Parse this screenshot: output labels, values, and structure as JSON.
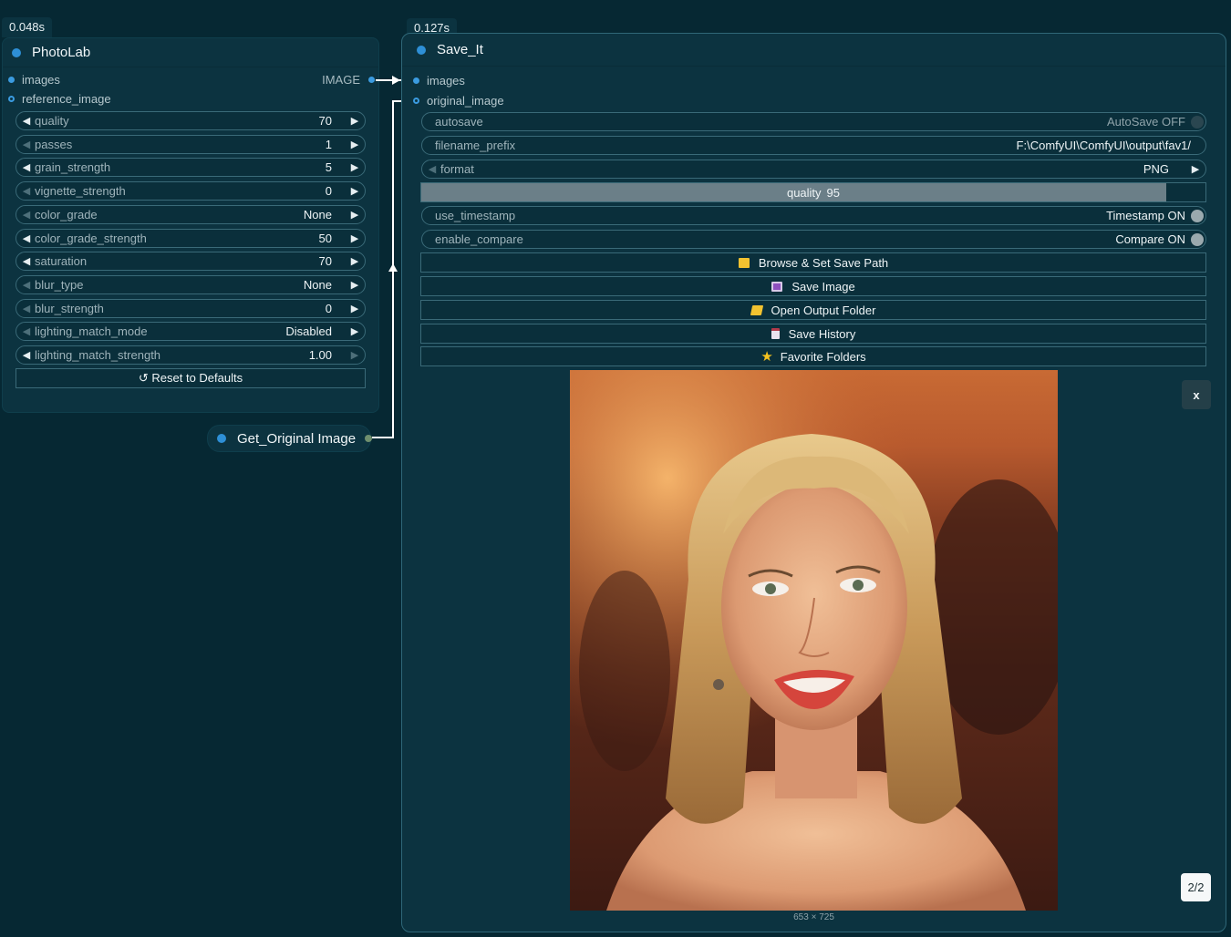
{
  "photolab": {
    "timing": "0.048s",
    "title": "PhotoLab",
    "inputs": [
      {
        "label": "images",
        "type": "IMAGE"
      },
      {
        "label": "reference_image"
      }
    ],
    "widgets": [
      {
        "label": "quality",
        "value": "70"
      },
      {
        "label": "passes",
        "value": "1"
      },
      {
        "label": "grain_strength",
        "value": "5"
      },
      {
        "label": "vignette_strength",
        "value": "0"
      },
      {
        "label": "color_grade",
        "value": "None"
      },
      {
        "label": "color_grade_strength",
        "value": "50"
      },
      {
        "label": "saturation",
        "value": "70"
      },
      {
        "label": "blur_type",
        "value": "None"
      },
      {
        "label": "blur_strength",
        "value": "0"
      },
      {
        "label": "lighting_match_mode",
        "value": "Disabled"
      },
      {
        "label": "lighting_match_strength",
        "value": "1.00"
      }
    ],
    "reset_label": "↺ Reset to Defaults"
  },
  "get_original": {
    "title": "Get_Original Image"
  },
  "save_it": {
    "timing": "0.127s",
    "title": "Save_It",
    "inputs": [
      {
        "label": "images"
      },
      {
        "label": "original_image"
      }
    ],
    "autosave": {
      "label": "autosave",
      "value": "AutoSave OFF"
    },
    "filename_prefix": {
      "label": "filename_prefix",
      "value": "F:\\ComfyUI\\ComfyUI\\output\\fav1/"
    },
    "format": {
      "label": "format",
      "value": "PNG"
    },
    "quality": {
      "label": "quality",
      "value": "95",
      "fraction": 0.95
    },
    "use_timestamp": {
      "label": "use_timestamp",
      "value": "Timestamp ON"
    },
    "enable_compare": {
      "label": "enable_compare",
      "value": "Compare ON"
    },
    "buttons": [
      {
        "label": "Browse & Set Save Path",
        "icon": "folder-icon"
      },
      {
        "label": "Save Image",
        "icon": "floppy-disk-icon"
      },
      {
        "label": "Open Output Folder",
        "icon": "open-folder-icon"
      },
      {
        "label": "Save History",
        "icon": "notepad-icon"
      },
      {
        "label": "Favorite Folders",
        "icon": "star-icon"
      }
    ],
    "preview": {
      "dimensions": "653 × 725",
      "close_label": "x",
      "page_indicator": "2/2"
    }
  },
  "colors": {
    "canvas": "#062833",
    "node_bg": "#0c3340",
    "slot_blue": "#3b9be0",
    "quality_fill": "#6b7f88"
  }
}
